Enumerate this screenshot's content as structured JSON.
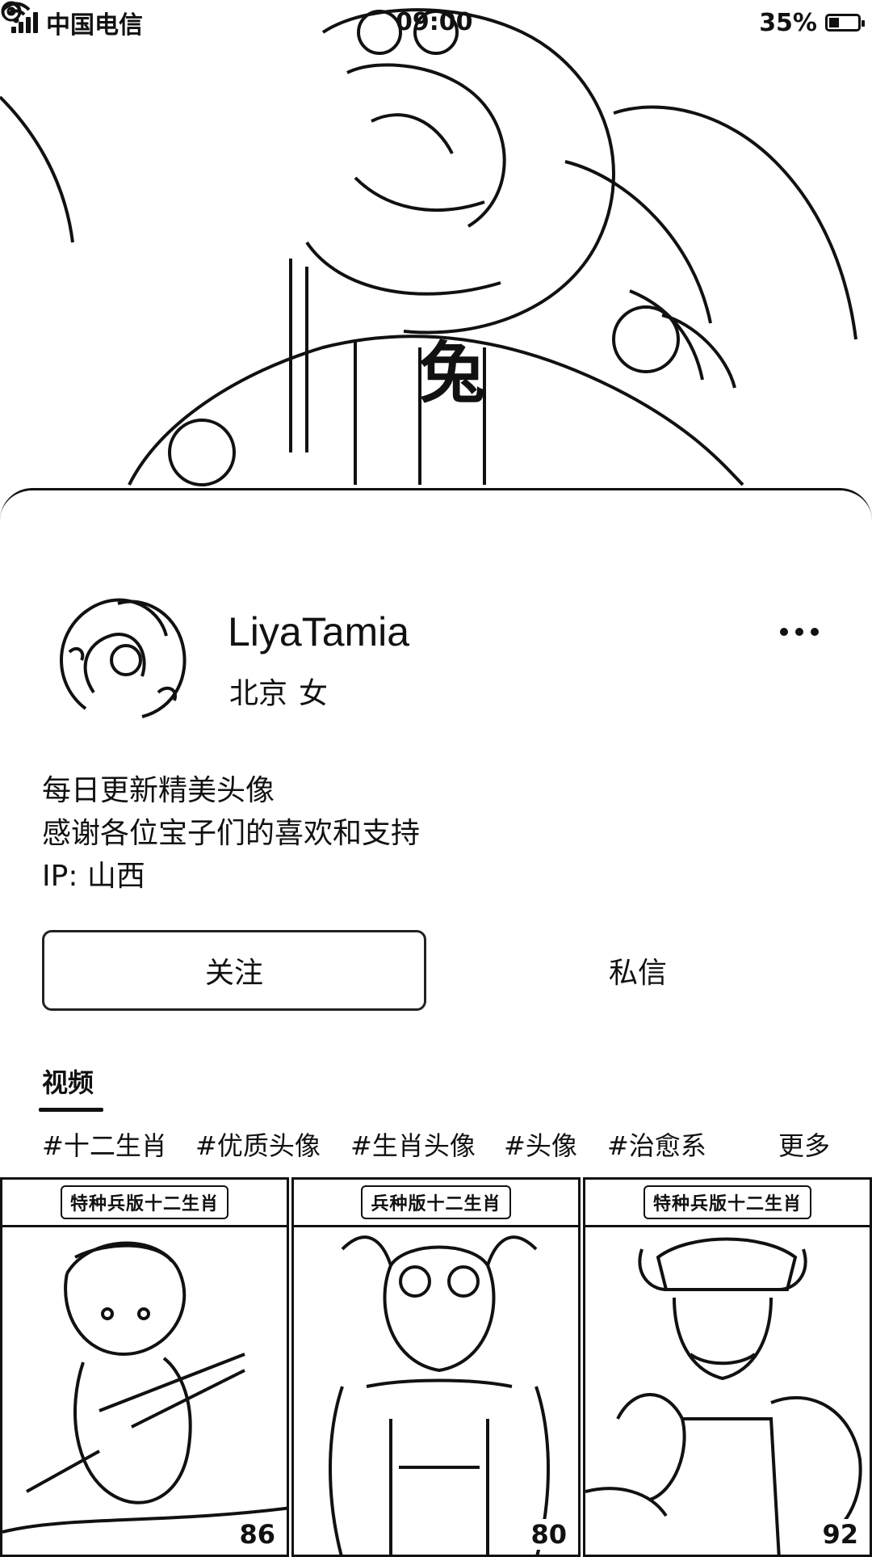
{
  "status_bar": {
    "carrier": "中国电信",
    "time": "09:00",
    "battery": "35%",
    "battery_level": 0.35
  },
  "banner": {
    "overlay_text": "兔"
  },
  "profile": {
    "username": "LiyaTamia",
    "city": "北京",
    "gender": "女",
    "bio": [
      "每日更新精美头像",
      "感谢各位宝子们的喜欢和支持",
      "IP: 山西"
    ]
  },
  "actions": {
    "follow": "关注",
    "message": "私信"
  },
  "tabs": {
    "active": "视频"
  },
  "tags": [
    "#十二生肖",
    "#优质头像",
    "#生肖头像",
    "#头像",
    "#治愈系",
    "更多"
  ],
  "videos": [
    {
      "title": "特种兵版十二生肖",
      "likes": "86"
    },
    {
      "title": "兵种版十二生肖",
      "likes": "80"
    },
    {
      "title": "特种兵版十二生肖",
      "likes": "92"
    }
  ]
}
